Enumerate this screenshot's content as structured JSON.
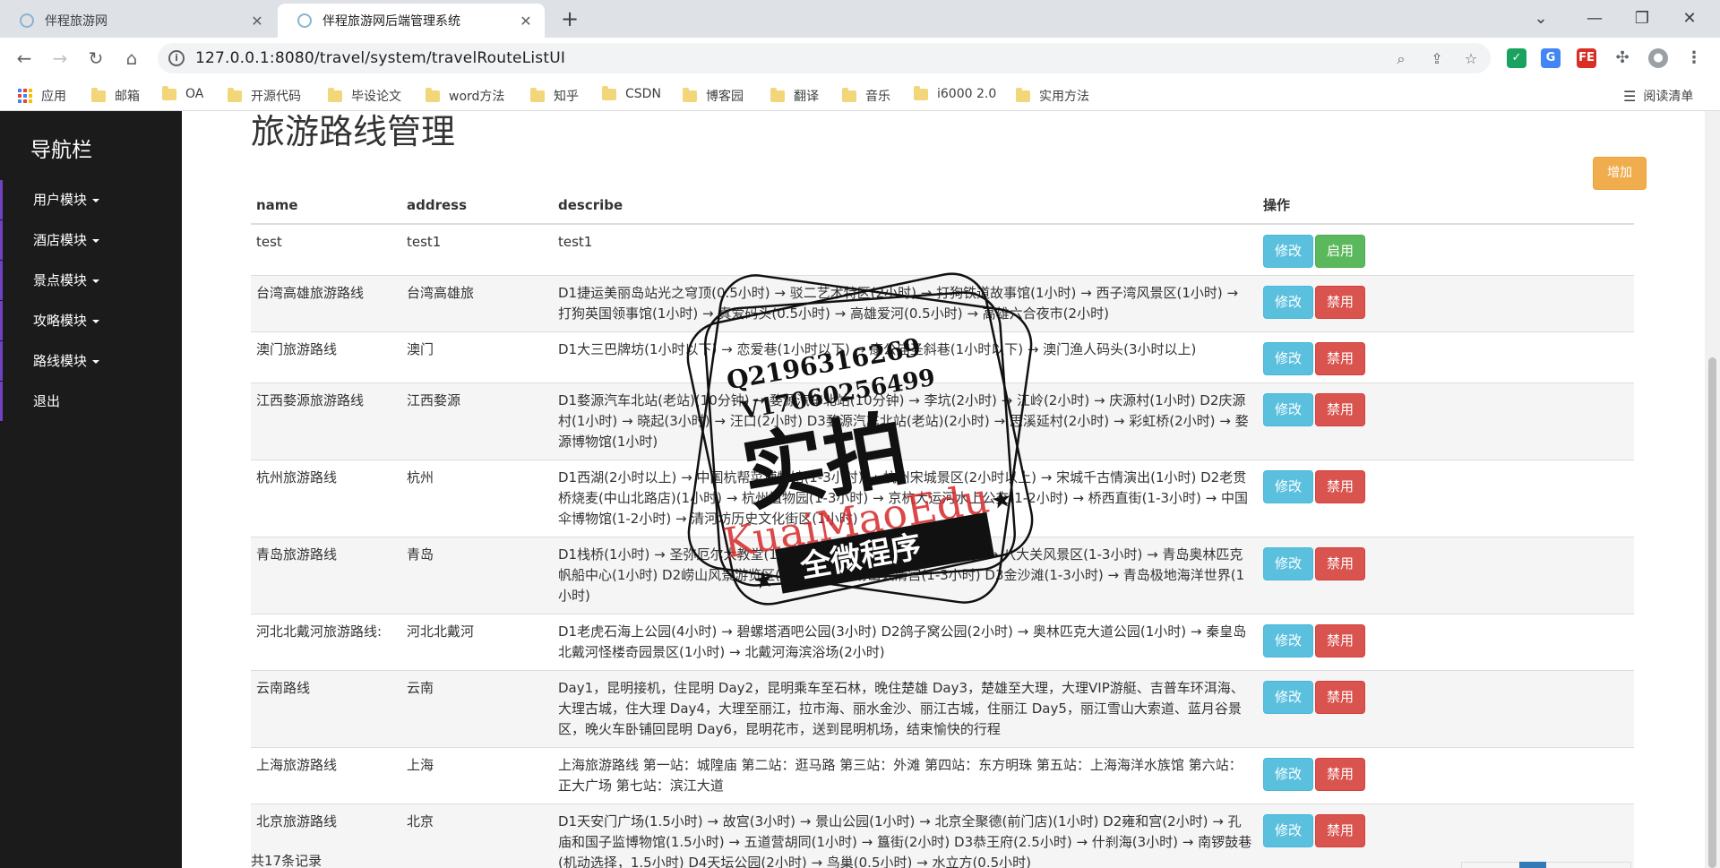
{
  "browser": {
    "tabs": [
      {
        "title": "伴程旅游网",
        "active": false
      },
      {
        "title": "伴程旅游网后端管理系统",
        "active": true
      }
    ],
    "url": "127.0.0.1:8080/travel/system/travelRouteListUI",
    "bookmarks": [
      "应用",
      "邮箱",
      "OA",
      "开源代码",
      "毕设论文",
      "word方法",
      "知乎",
      "CSDN",
      "博客园",
      "翻译",
      "音乐",
      "i6000 2.0",
      "实用方法"
    ],
    "reading_list": "阅读清单"
  },
  "sidebar": {
    "title": "导航栏",
    "items": [
      {
        "label": "用户模块"
      },
      {
        "label": "酒店模块"
      },
      {
        "label": "景点模块"
      },
      {
        "label": "攻略模块"
      },
      {
        "label": "路线模块"
      },
      {
        "label": "退出"
      }
    ]
  },
  "main": {
    "title": "旅游路线管理",
    "add_label": "增加",
    "columns": [
      "name",
      "address",
      "describe",
      "操作"
    ],
    "edit_label": "修改",
    "rows": [
      {
        "name": "test",
        "address": "test1",
        "describe": "test1",
        "action": "启用"
      },
      {
        "name": "台湾高雄旅游路线",
        "address": "台湾高雄旅",
        "describe": "D1捷运美丽岛站光之穹顶(0.5小时) → 驳二艺术特区(2小时) → 打狗铁道故事馆(1小时) → 西子湾风景区(1小时) → 打狗英国领事馆(1小时) → 真爱码头(0.5小时) → 高雄爱河(0.5小时) → 高雄六合夜市(2小时)",
        "action": "禁用"
      },
      {
        "name": "澳门旅游路线",
        "address": "澳门",
        "describe": "D1大三巴牌坊(1小时以下) → 恋爱巷(1小时以下) → 康公庙圣斜巷(1小时以下) → 澳门渔人码头(3小时以上)",
        "action": "禁用"
      },
      {
        "name": "江西婺源旅游路线",
        "address": "江西婺源",
        "describe": "D1婺源汽车北站(老站)(10分钟) → 婺源汽车北站(10分钟) → 李坑(2小时) → 江岭(2小时) → 庆源村(1小时) D2庆源村(1小时) → 晓起(3小时) → 汪口(2小时) D3婺源汽车北站(老站)(2小时) → 思溪延村(2小时) → 彩虹桥(2小时) → 婺源博物馆(1小时)",
        "action": "禁用"
      },
      {
        "name": "杭州旅游路线",
        "address": "杭州",
        "describe": "D1西湖(2小时以上) → 中国杭帮菜博物馆(1-3小时) → 杭州宋城景区(2小时以上) → 宋城千古情演出(1小时) D2老贯桥烧麦(中山北路店)(1小时) → 杭州植物园(1-3小时) → 京杭大运河水上公交(1-2小时) → 桥西直街(1-3小时) → 中国伞博物馆(1-2小时) → 清河坊历史文化街区(1小时)",
        "action": "禁用"
      },
      {
        "name": "青岛旅游路线",
        "address": "青岛",
        "describe": "D1栈桥(1小时) → 圣弥厄尔大教堂(1小时) → 青岛啤酒博物馆(1-2小时) → 八大关风景区(1-3小时) → 青岛奥林匹克帆船中心(1小时) D2崂山风景游览区(1-3小时) → 崂山太清宫(1-3小时) D3金沙滩(1-3小时) → 青岛极地海洋世界(1小时)",
        "action": "禁用"
      },
      {
        "name": "河北北戴河旅游路线:",
        "address": "河北北戴河",
        "describe": "D1老虎石海上公园(4小时) → 碧螺塔酒吧公园(3小时) D2鸽子窝公园(2小时) → 奥林匹克大道公园(1小时) → 秦皇岛北戴河怪楼奇园景区(1小时) → 北戴河海滨浴场(2小时)",
        "action": "禁用"
      },
      {
        "name": "云南路线",
        "address": "云南",
        "describe": "Day1，昆明接机，住昆明 Day2，昆明乘车至石林，晚住楚雄 Day3，楚雄至大理，大理VIP游艇、吉普车环洱海、大理古城，住大理 Day4，大理至丽江，拉市海、丽水金沙、丽江古城，住丽江 Day5，丽江雪山大索道、蓝月谷景区，晚火车卧铺回昆明 Day6，昆明花市，送到昆明机场，结束愉快的行程",
        "action": "禁用"
      },
      {
        "name": "上海旅游路线",
        "address": "上海",
        "describe": "上海旅游路线 第一站：城隍庙 第二站：逛马路 第三站：外滩 第四站：东方明珠 第五站：上海海洋水族馆 第六站：正大广场 第七站：滨江大道",
        "action": "禁用"
      },
      {
        "name": "北京旅游路线",
        "address": "北京",
        "describe": "D1天安门广场(1.5小时) → 故宫(3小时) → 景山公园(1小时) → 北京全聚德(前门店)(1小时) D2雍和宫(2小时) → 孔庙和国子监博物馆(1.5小时) → 五道营胡同(1小时) → 簋街(2小时) D3恭王府(2.5小时) → 什刹海(3小时) → 南锣鼓巷(机动选择，1.5小时) D4天坛公园(2小时) → 鸟巢(0.5小时) → 水立方(0.5小时)",
        "action": "禁用"
      }
    ],
    "total": "共17条记录"
  },
  "watermark": {
    "qq": "Q2196316269",
    "wx": "V17060256499",
    "main": "实拍",
    "brand": "KuaiMaoEdu",
    "sub": "全微程序"
  }
}
